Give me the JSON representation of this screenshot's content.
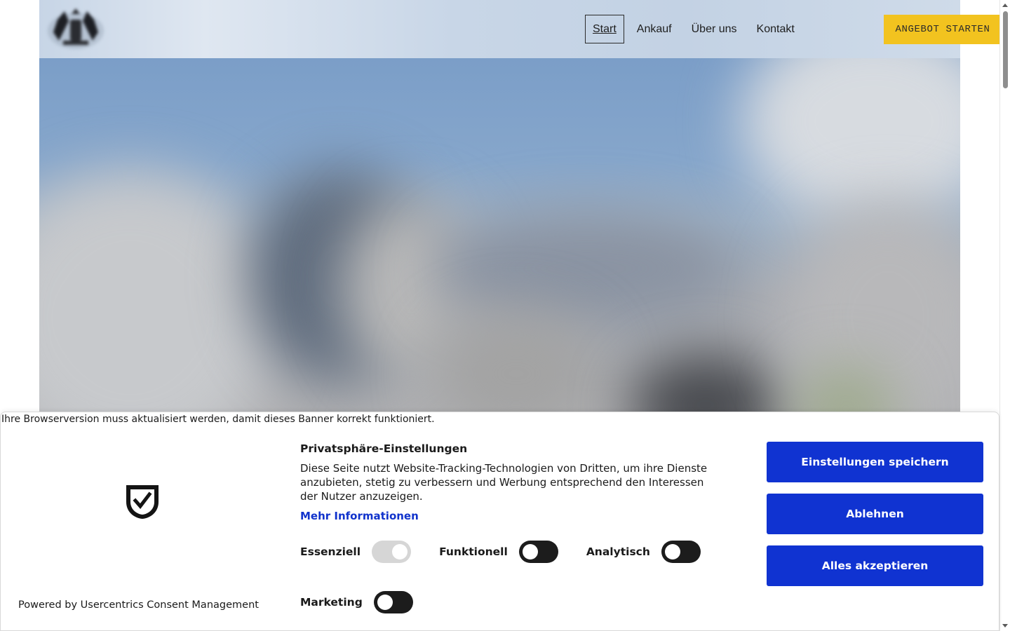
{
  "header": {
    "nav": [
      {
        "label": "Start",
        "active": true
      },
      {
        "label": "Ankauf",
        "active": false
      },
      {
        "label": "Über uns",
        "active": false
      },
      {
        "label": "Kontakt",
        "active": false
      }
    ],
    "cta_label": "ANGEBOT STARTEN",
    "cta_color": "#f2c31f"
  },
  "banner": {
    "browser_warning": "Ihre Browserversion muss aktualisiert werden, damit dieses Banner korrekt funktioniert.",
    "logo_icon": "shield-check-icon",
    "title": "Privatsphäre-Einstellungen",
    "description": "Diese Seite nutzt Website-Tracking-Technologien von Dritten, um ihre Dienste anzubieten, stetig zu verbessern und Werbung entsprechend den Interessen der Nutzer anzuzeigen.",
    "more_info": "Mehr Informationen",
    "toggles": [
      {
        "label": "Essenziell",
        "on": true,
        "disabled": true
      },
      {
        "label": "Funktionell",
        "on": false,
        "disabled": false
      },
      {
        "label": "Analytisch",
        "on": false,
        "disabled": false
      },
      {
        "label": "Marketing",
        "on": false,
        "disabled": false
      }
    ],
    "buttons": {
      "save": "Einstellungen speichern",
      "deny": "Ablehnen",
      "accept_all": "Alles akzeptieren"
    },
    "button_color": "#1033d1",
    "link_color": "#1133cc",
    "powered_by": "Powered by Usercentrics Consent Management"
  }
}
